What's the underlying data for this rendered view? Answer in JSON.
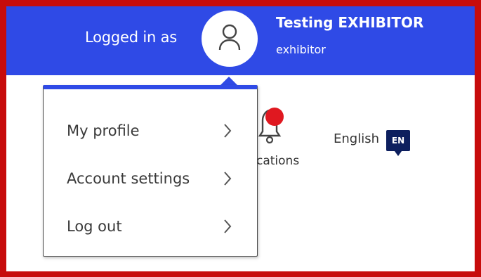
{
  "header": {
    "logged_in_label": "Logged in as",
    "user_name": "Testing EXHIBITOR",
    "user_role": "exhibitor",
    "avatar_icon": "user-icon",
    "background_color": "#2f4ae6"
  },
  "user_menu": {
    "items": [
      {
        "label": "My profile",
        "icon": "chevron-right-icon"
      },
      {
        "label": "Account settings",
        "icon": "chevron-right-icon"
      },
      {
        "label": "Log out",
        "icon": "chevron-right-icon"
      }
    ]
  },
  "notifications": {
    "label": "cations",
    "icon": "bell-icon",
    "badge_color": "#e01820"
  },
  "language": {
    "label": "English",
    "code": "EN",
    "badge_color": "#0d1f5e"
  },
  "frame_color": "#c70c0c"
}
